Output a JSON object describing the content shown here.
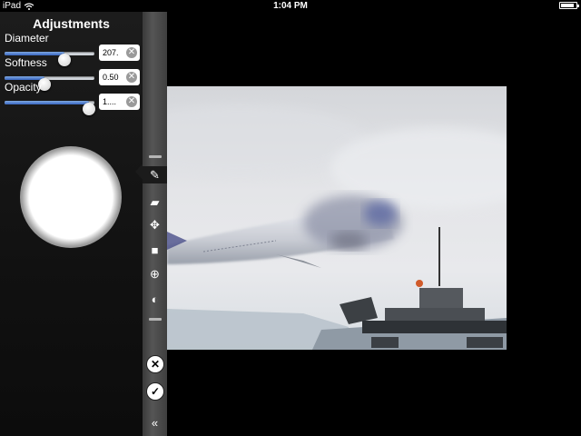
{
  "status_bar": {
    "device": "iPad",
    "time": "1:04 PM",
    "battery_level": 0.85
  },
  "panel": {
    "title": "Adjustments",
    "sliders": [
      {
        "label": "Diameter",
        "value_text": "207.",
        "level": 0.67
      },
      {
        "label": "Softness",
        "value_text": "0.50",
        "level": 0.44
      },
      {
        "label": "Opacity",
        "value_text": "1....",
        "level": 0.94
      }
    ],
    "clear_glyph": "✕"
  },
  "tools": [
    {
      "name": "brush-icon",
      "glyph": "✎",
      "selected": true
    },
    {
      "name": "eraser-icon",
      "glyph": "▰",
      "selected": false
    },
    {
      "name": "move-icon",
      "glyph": "✥",
      "selected": false
    },
    {
      "name": "rectangle-icon",
      "glyph": "■",
      "selected": false
    },
    {
      "name": "target-icon",
      "glyph": "⊕",
      "selected": false
    },
    {
      "name": "contrast-icon",
      "glyph": "◐",
      "selected": false
    }
  ],
  "actions": {
    "cancel_glyph": "✕",
    "confirm_glyph": "✓",
    "collapse_glyph": "«"
  }
}
